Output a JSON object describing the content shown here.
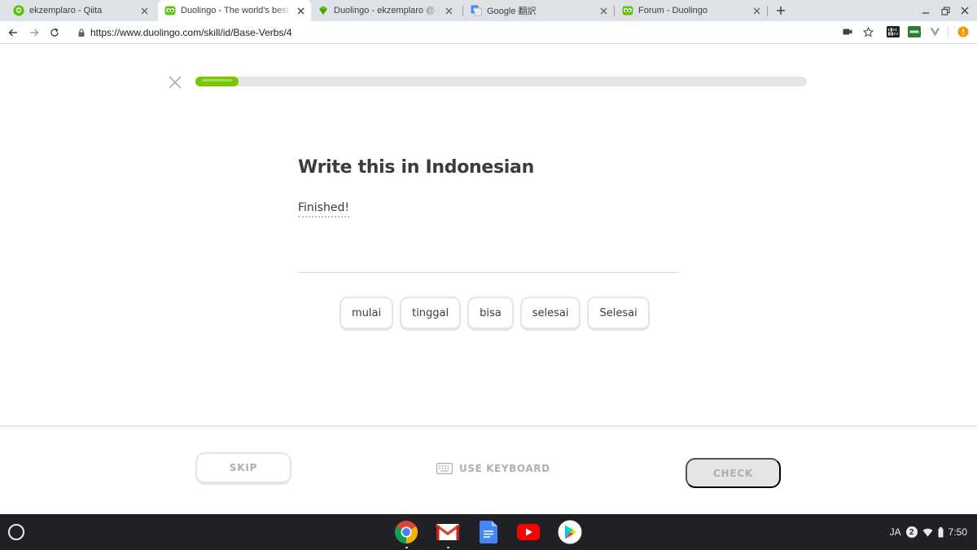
{
  "browser": {
    "tabs": [
      {
        "title": "ekzemplaro - Qiita",
        "favicon": "qiita-icon",
        "active": false
      },
      {
        "title": "Duolingo - The world's best way to learn",
        "favicon": "duolingo-owl-icon",
        "active": true
      },
      {
        "title": "Duolingo - ekzemplaro @ duome.eu",
        "favicon": "duome-gem-icon",
        "active": false
      },
      {
        "title": "Google 翻訳",
        "favicon": "google-translate-icon",
        "active": false
      },
      {
        "title": "Forum - Duolingo",
        "favicon": "duolingo-owl-icon",
        "active": false
      }
    ],
    "url": "https://www.duolingo.com/skill/id/Base-Verbs/4"
  },
  "lesson": {
    "progress": 0.07,
    "heading": "Write this in Indonesian",
    "prompt": "Finished!",
    "word_bank": [
      "mulai",
      "tinggal",
      "bisa",
      "selesai",
      "Selesai"
    ],
    "skip_label": "SKIP",
    "keyboard_label": "USE KEYBOARD",
    "check_label": "CHECK"
  },
  "shelf": {
    "apps": [
      "chrome-icon",
      "gmail-icon",
      "google-docs-icon",
      "youtube-icon",
      "play-store-icon"
    ],
    "ime": "JA",
    "notifications": "2",
    "time": "7:50"
  },
  "colors": {
    "progress_fill": "#78c800",
    "progress_track": "#e5e5e5",
    "text": "#3c3c3c",
    "disabled": "#afafaf"
  }
}
